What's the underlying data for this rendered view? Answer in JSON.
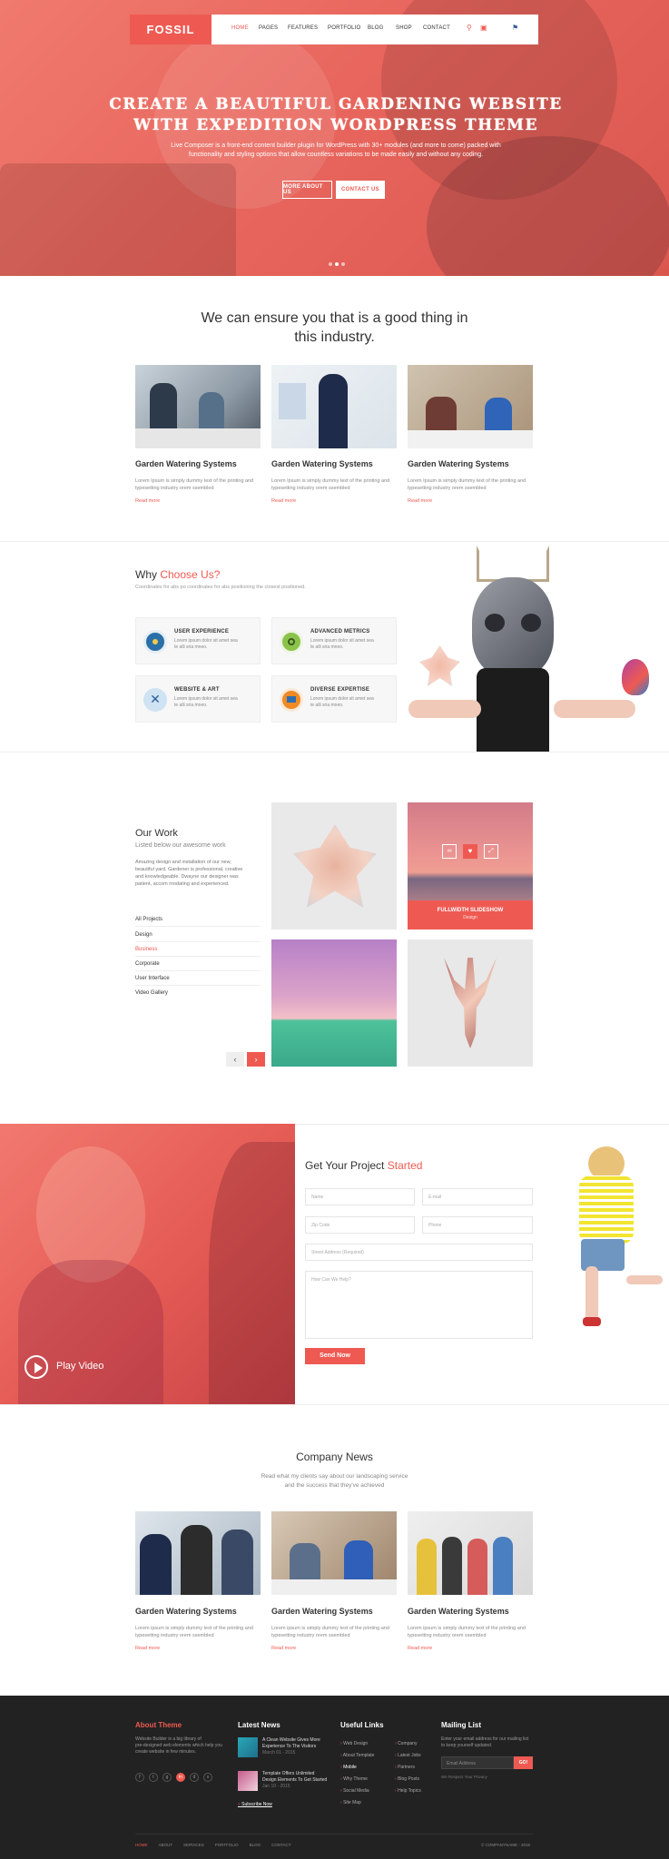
{
  "nav": {
    "logo": "FOSSIL",
    "items": [
      "HOME",
      "PAGES",
      "FEATURES",
      "PORTFOLIO",
      "BLOG",
      "SHOP",
      "CONTACT"
    ],
    "active": "HOME"
  },
  "hero": {
    "title_line1": "Create A Beautiful Gardening Website",
    "title_line2": "With Expedition WordPress Theme",
    "subtitle_line1": "Live Composer is a front-end content builder plugin for WordPress with 30+ modules (and more to come) packed with",
    "subtitle_line2": "functionality and styling options that allow countless variations to be made easily and without any coding.",
    "btn_more": "MORE ABOUT US",
    "btn_contact": "CONTACT US"
  },
  "intro": {
    "line1": "We can ensure you that is a good thing in",
    "line2": "this industry."
  },
  "services": [
    {
      "title": "Garden Watering Systems",
      "text1": "Lorem Ipsum is simply dummy text of the printing and",
      "text2": "typesetting industry orem ssembled",
      "link": "Read more"
    },
    {
      "title": "Garden Watering Systems",
      "text1": "Lorem Ipsum is simply dummy text of the printing and",
      "text2": "typesetting industry orem ssembled",
      "link": "Read more"
    },
    {
      "title": "Garden Watering Systems",
      "text1": "Lorem Ipsum is simply dummy text of the printing and",
      "text2": "typesetting industry orem ssembled",
      "link": "Read more"
    }
  ],
  "why": {
    "title_plain": "Why ",
    "title_accent": "Choose Us?",
    "subtitle": "Coordinates for abs po coordinates for abs positioning the closest positioned.",
    "features": [
      {
        "title": "USER EXPERIENCE",
        "text1": "Lorem ipsum dolor sit amet sea",
        "text2": "te alli sria mneo.",
        "icon": "user-experience-icon",
        "color": "#2a6fa8"
      },
      {
        "title": "ADVANCED METRICS",
        "text1": "Lorem ipsum dolor sit amet sea",
        "text2": "te alli sria mneo.",
        "icon": "gear-icon",
        "color": "#8bc34a"
      },
      {
        "title": "WEBSITE & ART",
        "text1": "Lorem ipsum dolor sit amet sea",
        "text2": "te alli sria mneo.",
        "icon": "tools-icon",
        "color": "#2a8fd8"
      },
      {
        "title": "DIVERSE EXPERTISE",
        "text1": "Lorem ipsum dolor sit amet sea",
        "text2": "te alli sria mneo.",
        "icon": "chart-icon",
        "color": "#f08a24"
      }
    ]
  },
  "work": {
    "title": "Our Work",
    "subtitle": "Listed below our awesome work",
    "desc1": "Amazing design and installation of our new,",
    "desc2": "beautiful yard. Gardener is professional, creative",
    "desc3": "and knowledgeable. Dwayne our designer was",
    "desc4": "patient, accom modating and experienced.",
    "filters": [
      "All Projects",
      "Design",
      "Business",
      "Corporate",
      "User Interface",
      "Video Gallery"
    ],
    "active_filter": "Business",
    "overlay_title": "FULLWIDTH SLIDESHOW",
    "overlay_sub": "Design"
  },
  "project": {
    "title_plain": "Get Your Project ",
    "title_accent": "Started",
    "name": "Name",
    "email": "E-mail",
    "zip": "Zip Code",
    "phone": "Phone",
    "address": "Street Address (Required)",
    "message": "How Can We Help?",
    "send": "Send Now",
    "play": "Play Video"
  },
  "news": {
    "title": "Company News",
    "sub1": "Read what my clients say about our landscaping service",
    "sub2": "and the success that they've achieved",
    "items": [
      {
        "title": "Garden Watering Systems",
        "text1": "Lorem ipsum is simply dummy text of the printing and",
        "text2": "typesetting industry orem ssembled",
        "link": "Read more"
      },
      {
        "title": "Garden Watering Systems",
        "text1": "Lorem ipsum is simply dummy text of the printing and",
        "text2": "typesetting industry orem ssembled",
        "link": "Read more"
      },
      {
        "title": "Garden Watering Systems",
        "text1": "Lorem ipsum is simply dummy text of the printing and",
        "text2": "typesetting industry orem ssembled",
        "link": "Read more"
      }
    ]
  },
  "footer": {
    "about_title": "About Theme",
    "about1": "Website Builder is a big library of",
    "about2": "pre-designed web elements which help you",
    "about3": "create website in few minutes.",
    "news_title": "Latest News",
    "news1_l1": "A Clean Website Gives More",
    "news1_l2": "Experience To The Visitors",
    "news1_date": "March 01 - 2015",
    "news2_l1": "Template Offers Unlimited",
    "news2_l2": "Design Elements To Get Started",
    "news2_date": "Jan 10 - 2015",
    "subscribe": "Subscribe Now",
    "links_title": "Useful Links",
    "links_col1": [
      "Web Design",
      "About Template",
      "Mobile",
      "Why Theme",
      "Social Media",
      "Site Map"
    ],
    "links_col2": [
      "Company",
      "Latest Jobs",
      "Partners",
      "Blog Posts",
      "Help Topics"
    ],
    "mail_title": "Mailing List",
    "mail1": "Enter your email address for our mailing list",
    "mail2": "to keep yourself updated.",
    "email_ph": "Email Address",
    "go": "GO!",
    "privacy": "We Respect Your Privacy",
    "bottom_links": [
      "HOME",
      "ABOUT",
      "SERVICES",
      "PORTFOLIO",
      "BLOG",
      "CONTACT"
    ],
    "copyright": "© COMPANYNAME - 2015"
  },
  "colors": {
    "accent": "#ee5a52",
    "footer_bg": "#222222"
  }
}
